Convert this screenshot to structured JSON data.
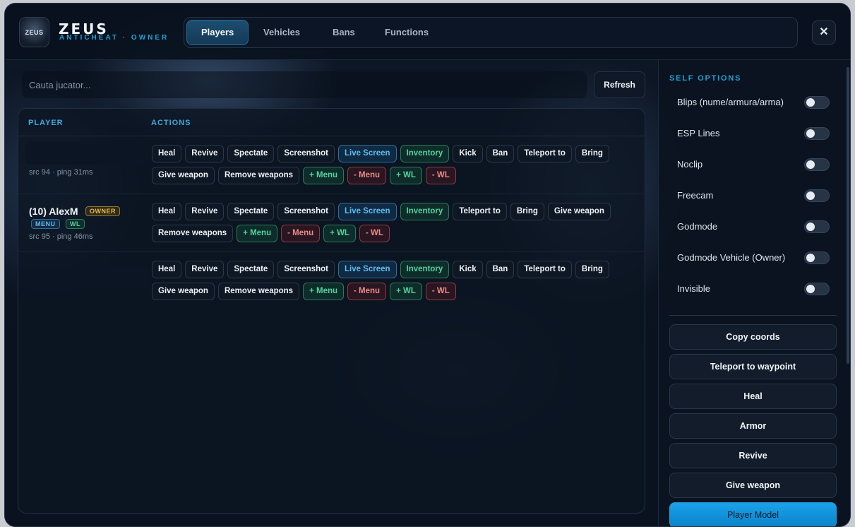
{
  "brand": {
    "title": "ZEUS",
    "subtitle": "ANTICHEAT · OWNER",
    "logo_text": "ZEUS"
  },
  "tabs": [
    {
      "label": "Players",
      "active": true
    },
    {
      "label": "Vehicles",
      "active": false
    },
    {
      "label": "Bans",
      "active": false
    },
    {
      "label": "Functions",
      "active": false
    }
  ],
  "close_label": "✕",
  "search": {
    "placeholder": "Cauta jucator...",
    "value": ""
  },
  "refresh_label": "Refresh",
  "table": {
    "headers": {
      "player": "PLAYER",
      "actions": "ACTIONS"
    },
    "rows": [
      {
        "name": "",
        "meta": "src 94 · ping 31ms",
        "buttons": [
          "Heal",
          "Revive",
          "Spectate",
          "Screenshot",
          "Live Screen",
          "Inventory",
          "Kick",
          "Ban",
          "Teleport to",
          "Bring",
          "Give weapon",
          "Remove weapons",
          "+ Menu",
          "- Menu",
          "+ WL",
          "- WL"
        ]
      },
      {
        "name": "(10) AlexM",
        "badges": {
          "owner": "OWNER",
          "menu": "MENU",
          "wl": "WL"
        },
        "meta": "src 95 · ping 46ms",
        "buttons": [
          "Heal",
          "Revive",
          "Spectate",
          "Screenshot",
          "Live Screen",
          "Inventory",
          "Teleport to",
          "Bring",
          "Give weapon",
          "Remove weapons",
          "+ Menu",
          "- Menu",
          "+ WL",
          "- WL"
        ]
      },
      {
        "name": "",
        "meta": "",
        "buttons": [
          "Heal",
          "Revive",
          "Spectate",
          "Screenshot",
          "Live Screen",
          "Inventory",
          "Kick",
          "Ban",
          "Teleport to",
          "Bring",
          "Give weapon",
          "Remove weapons",
          "+ Menu",
          "- Menu",
          "+ WL",
          "- WL"
        ]
      }
    ]
  },
  "self_options": {
    "title": "SELF OPTIONS",
    "toggles": [
      {
        "label": "Blips (nume/armura/arma)",
        "on": false
      },
      {
        "label": "ESP Lines",
        "on": false
      },
      {
        "label": "Noclip",
        "on": false
      },
      {
        "label": "Freecam",
        "on": false
      },
      {
        "label": "Godmode",
        "on": false
      },
      {
        "label": "Godmode Vehicle (Owner)",
        "on": false
      },
      {
        "label": "Invisible",
        "on": false
      }
    ],
    "actions": [
      "Copy coords",
      "Teleport to waypoint",
      "Heal",
      "Armor",
      "Revive",
      "Give weapon",
      "Player Model"
    ]
  },
  "colors": {
    "accent": "#1fa3d6",
    "owner_badge": "#e9b93e",
    "wl_green": "#55d19f",
    "remove_red": "#e98a88"
  }
}
